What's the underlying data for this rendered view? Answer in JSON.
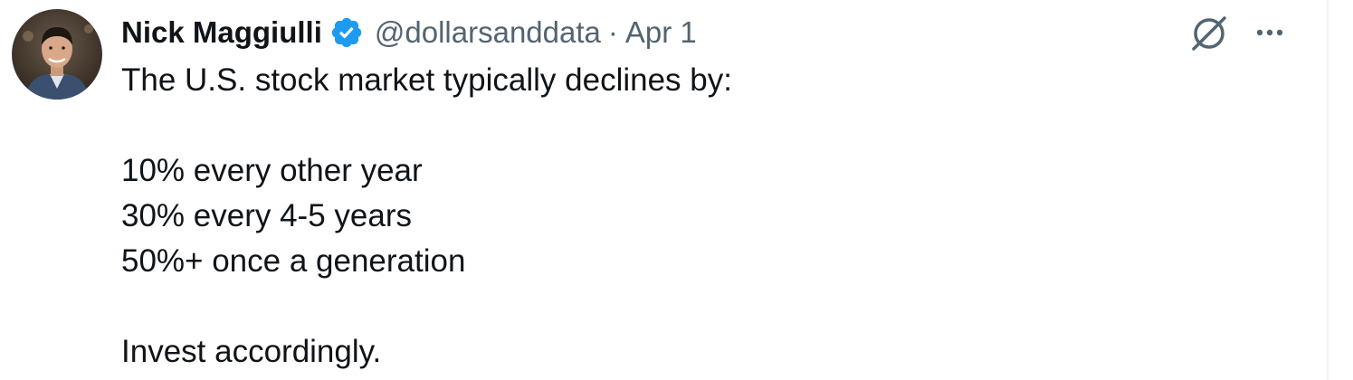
{
  "tweet": {
    "author": {
      "display_name": "Nick Maggiulli",
      "handle": "@dollarsanddata",
      "verified": true,
      "avatar_icon": "user-avatar-photo"
    },
    "separator": "·",
    "date": "Apr 1",
    "text_lines": [
      "The U.S. stock market typically declines by:",
      "",
      "10% every other year",
      "30% every 4-5 years",
      "50%+ once a generation",
      "",
      "Invest accordingly."
    ],
    "actions": {
      "grok_icon": "grok-icon",
      "more_icon": "more-options-icon"
    }
  },
  "colors": {
    "primary_text": "#0f1419",
    "secondary_text": "#536471",
    "verified_badge": "#1d9bf0",
    "background": "#ffffff",
    "divider": "#eff3f4"
  }
}
